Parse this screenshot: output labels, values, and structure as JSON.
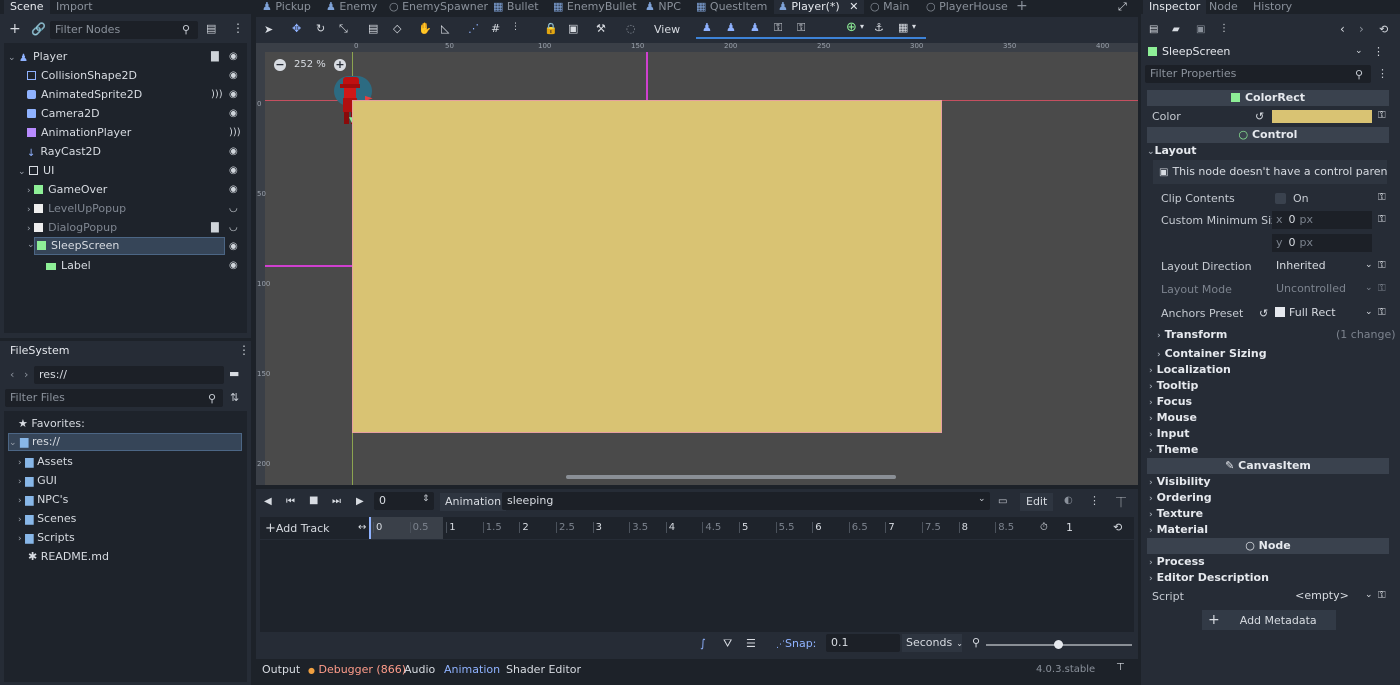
{
  "scene_dock": {
    "tabs": [
      "Scene",
      "Import"
    ],
    "filter_placeholder": "Filter Nodes",
    "nodes": [
      {
        "label": "Player"
      },
      {
        "label": "CollisionShape2D"
      },
      {
        "label": "AnimatedSprite2D"
      },
      {
        "label": "Camera2D"
      },
      {
        "label": "AnimationPlayer"
      },
      {
        "label": "RayCast2D"
      },
      {
        "label": "UI"
      },
      {
        "label": "GameOver"
      },
      {
        "label": "LevelUpPopup"
      },
      {
        "label": "DialogPopup"
      },
      {
        "label": "SleepScreen"
      },
      {
        "label": "Label"
      }
    ]
  },
  "filesystem": {
    "title": "FileSystem",
    "path": "res://",
    "filter_placeholder": "Filter Files",
    "favorites_label": "Favorites:",
    "items": [
      {
        "label": "res://"
      },
      {
        "label": "Assets"
      },
      {
        "label": "GUI"
      },
      {
        "label": "NPC's"
      },
      {
        "label": "Scenes"
      },
      {
        "label": "Scripts"
      },
      {
        "label": "README.md"
      }
    ]
  },
  "editor_tabs": [
    "Pickup",
    "Enemy",
    "EnemySpawner",
    "Bullet",
    "EnemyBullet",
    "NPC",
    "QuestItem",
    "Player(*)",
    "Main",
    "PlayerHouse"
  ],
  "toolbar": {
    "view_label": "View"
  },
  "viewport": {
    "zoom": "252 %",
    "ruler_top": [
      "0",
      "50",
      "100",
      "150",
      "200",
      "250",
      "300",
      "350",
      "400"
    ],
    "ruler_left": [
      "0",
      "50",
      "100",
      "150",
      "200"
    ],
    "rect_color": "#d9c373"
  },
  "animation": {
    "frame_value": "0",
    "animation_label": "Animation",
    "animation_name": "sleeping",
    "edit_label": "Edit",
    "add_track_label": "Add Track",
    "timeline_ticks": [
      "0",
      "0.5",
      "1",
      "1.5",
      "2",
      "2.5",
      "3",
      "3.5",
      "4",
      "4.5",
      "5",
      "5.5",
      "6",
      "6.5",
      "7",
      "7.5",
      "8",
      "8.5"
    ],
    "length_value": "1",
    "snap_label": "Snap:",
    "snap_value": "0.1",
    "snap_unit": "Seconds"
  },
  "bottom_bar": {
    "tabs": [
      "Output",
      "Debugger (866)",
      "Audio",
      "Animation",
      "Shader Editor"
    ],
    "version": "4.0.3.stable"
  },
  "inspector": {
    "tabs": [
      "Inspector",
      "Node",
      "History"
    ],
    "object_name": "SleepScreen",
    "filter_placeholder": "Filter Properties",
    "colorrect_header": "ColorRect",
    "color_label": "Color",
    "color_value": "#d9c373",
    "control_header": "Control",
    "layout_label": "Layout",
    "layout_warning": "This node doesn't have a control parent.",
    "clip_contents_label": "Clip Contents",
    "clip_contents_value": "On",
    "min_size_label": "Custom Minimum Size",
    "min_size_x_label": "x",
    "min_size_x": "0",
    "min_size_y_label": "y",
    "min_size_y": "0",
    "px_unit": "px",
    "layout_direction_label": "Layout Direction",
    "layout_direction_value": "Inherited",
    "layout_mode_label": "Layout Mode",
    "layout_mode_value": "Uncontrolled",
    "anchors_label": "Anchors Preset",
    "anchors_value": "Full Rect",
    "transform_label": "Transform",
    "transform_changes": "(1 change)",
    "container_sizing_label": "Container Sizing",
    "control_categories": [
      "Localization",
      "Tooltip",
      "Focus",
      "Mouse",
      "Input",
      "Theme"
    ],
    "canvasitem_header": "CanvasItem",
    "canvas_categories": [
      "Visibility",
      "Ordering",
      "Texture",
      "Material"
    ],
    "node_header": "Node",
    "node_categories": [
      "Process",
      "Editor Description"
    ],
    "script_label": "Script",
    "script_value": "<empty>",
    "add_metadata_label": "Add Metadata"
  }
}
